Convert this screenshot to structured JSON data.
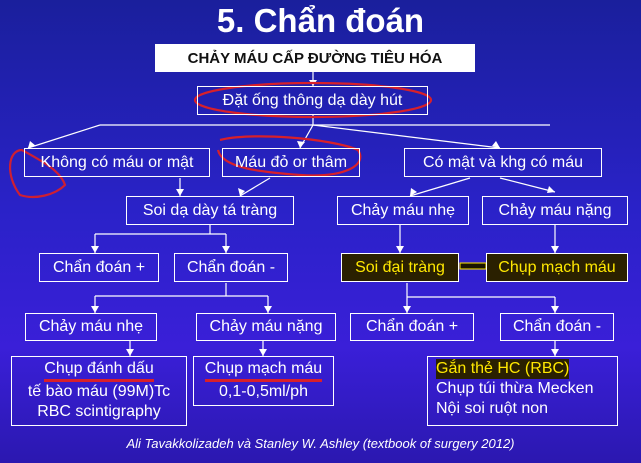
{
  "title": "5. Chẩn đoán",
  "nodes": {
    "root": "CHẢY MÁU CẤP ĐƯỜNG TIÊU HÓA",
    "ngt": "Đặt ống thông dạ dày hút",
    "no_blood": "Không có máu or mật",
    "red_blood": "Máu đỏ or thâm",
    "bile_no_blood": "Có mật và khg có máu",
    "egd": "Soi dạ dày tá tràng",
    "minor_bleed_r": "Chảy máu nhẹ",
    "major_bleed_r": "Chảy máu nặng",
    "dx_pos": "Chẩn đoán +",
    "dx_neg": "Chẩn đoán -",
    "colonoscopy": "Soi đại tràng",
    "angio_r": "Chụp mạch máu",
    "minor_bleed_l": "Chảy máu nhẹ",
    "major_bleed_l": "Chảy máu nặng",
    "dx_pos_r": "Chẩn đoán +",
    "dx_neg_r": "Chẩn đoán -",
    "tagged_l1": "Chụp đánh dấu",
    "tagged_l2": "tế bào máu (99M)Tc",
    "tagged_l3": "RBC scintigraphy",
    "angio_l1": "Chụp mạch máu",
    "angio_l2": "0,1-0,5ml/ph",
    "rbc_l1": "Gắn thẻ HC (RBC)",
    "rbc_l2": "Chụp túi thừa Mecken",
    "rbc_l3": "Nội soi ruột non"
  },
  "caption": "Ali Tavakkolizadeh và Stanley W. Ashley (textbook of surgery 2012)",
  "colors": {
    "background": "#2a22c8",
    "line": "#ffffff",
    "highlight": "#ffe800",
    "annotation": "#d8202a"
  }
}
